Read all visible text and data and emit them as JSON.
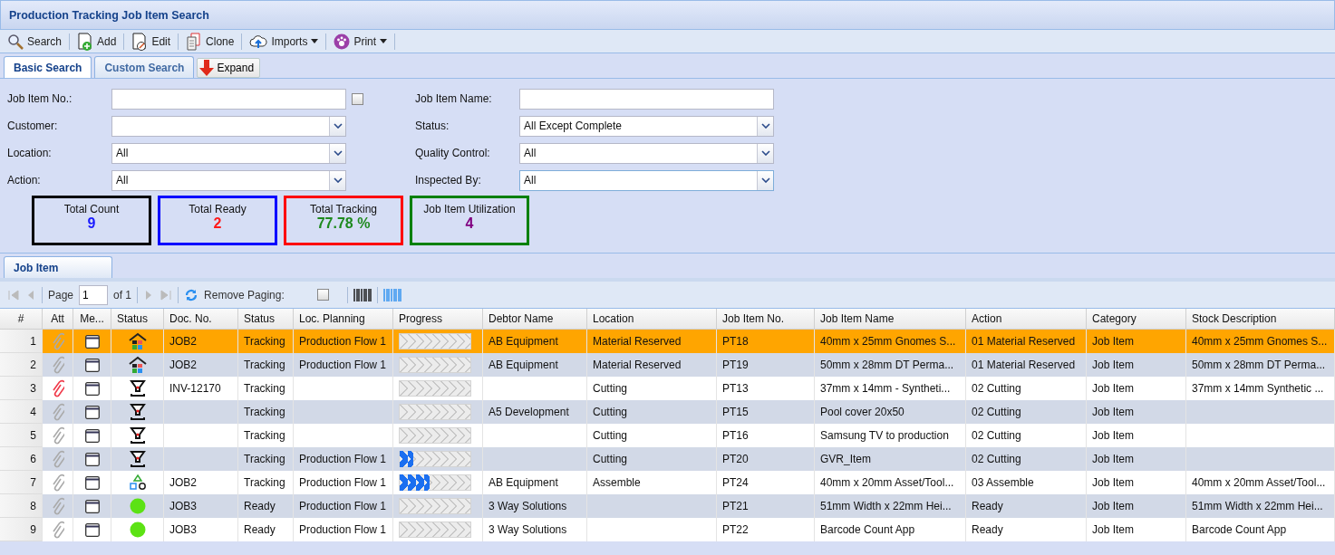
{
  "window": {
    "title": "Production Tracking Job Item Search"
  },
  "toolbar": [
    {
      "label": "Search",
      "kind": "search",
      "menu": false
    },
    {
      "label": "Add",
      "kind": "add",
      "menu": false
    },
    {
      "label": "Edit",
      "kind": "edit",
      "menu": false
    },
    {
      "label": "Clone",
      "kind": "clone",
      "menu": false
    },
    {
      "label": "Imports",
      "kind": "cloud",
      "menu": true
    },
    {
      "label": "Print",
      "kind": "paw",
      "menu": true
    }
  ],
  "search_tabs": [
    {
      "label": "Basic Search",
      "selected": true
    },
    {
      "label": "Custom Search",
      "selected": false
    }
  ],
  "expand_button": {
    "label": "Expand"
  },
  "filters_left": [
    {
      "label": "Job Item No.:",
      "kind": "text",
      "checkbox": true,
      "checked": false
    },
    {
      "label": "Customer:",
      "kind": "select"
    },
    {
      "label": "Location:",
      "kind": "select",
      "value": "All"
    },
    {
      "label": "Action:",
      "kind": "select",
      "value": "All"
    }
  ],
  "filters_right": [
    {
      "label": "Job Item Name:",
      "kind": "text"
    },
    {
      "label": "Status:",
      "kind": "select",
      "value": "All Except Complete"
    },
    {
      "label": "Quality Control:",
      "kind": "select",
      "value": "All"
    },
    {
      "label": "Inspected By:",
      "kind": "select",
      "value": "All",
      "focused": true
    }
  ],
  "summary": [
    {
      "label": "Total Count",
      "color": "#000000",
      "value": {
        "text": "9",
        "color": "#1a1aff"
      }
    },
    {
      "label": "Total Ready",
      "color": "#0000ff",
      "value": {
        "text": "2",
        "color": "#ff1a1a"
      }
    },
    {
      "label": "Total Tracking",
      "color": "#ff0000",
      "value": {
        "text": "77.78 %",
        "color": "#1e8a1e"
      }
    },
    {
      "label": "Job Item Utilization",
      "color": "#008000",
      "value": {
        "text": "4",
        "color": "#800080"
      }
    }
  ],
  "grid_tabs": [
    {
      "label": "Job Item",
      "selected": true
    }
  ],
  "paging": {
    "page_label": "Page",
    "page": "1",
    "of": "of 1",
    "remove_paging": "Remove Paging:",
    "remove_paging_checked": false
  },
  "table": {
    "columns": [
      "#",
      "Att",
      "Me...",
      "Status",
      "Doc. No.",
      "Status",
      "Loc. Planning",
      "Progress",
      "Debtor Name",
      "Location",
      "Job Item No.",
      "Job Item Name",
      "Action",
      "Category",
      "Stock Description"
    ],
    "rows": [
      {
        "num": "1",
        "flagged": false,
        "kind": "house",
        "doc": "JOB2",
        "status": "Tracking",
        "planning": "Production Flow 1",
        "level": 0,
        "debtor": "AB Equipment",
        "location": "Material Reserved",
        "item_no": "PT18",
        "name": "40mm x 25mm Gnomes S...",
        "action": "01 Material Reserved",
        "category": "Job Item",
        "stock": "40mm x 25mm Gnomes S...",
        "selected": true
      },
      {
        "num": "2",
        "flagged": false,
        "kind": "house",
        "doc": "JOB2",
        "status": "Tracking",
        "planning": "Production Flow 1",
        "level": 0,
        "debtor": "AB Equipment",
        "location": "Material Reserved",
        "item_no": "PT19",
        "name": "50mm x 28mm DT Perma...",
        "action": "01 Material Reserved",
        "category": "Job Item",
        "stock": "50mm x 28mm DT Perma...",
        "selected": false
      },
      {
        "num": "3",
        "flagged": true,
        "kind": "funnel",
        "doc": "INV-12170",
        "status": "Tracking",
        "level": 0,
        "location": "Cutting",
        "item_no": "PT13",
        "name": "37mm x 14mm - Syntheti...",
        "action": "02 Cutting",
        "category": "Job Item",
        "stock": "37mm x 14mm Synthetic ...",
        "selected": false
      },
      {
        "num": "4",
        "flagged": false,
        "kind": "funnel",
        "status": "Tracking",
        "level": 0,
        "debtor": "A5 Development",
        "location": "Cutting",
        "item_no": "PT15",
        "name": "Pool cover 20x50",
        "action": "02 Cutting",
        "category": "Job Item",
        "selected": false
      },
      {
        "num": "5",
        "flagged": false,
        "kind": "funnel",
        "status": "Tracking",
        "level": 0,
        "location": "Cutting",
        "item_no": "PT16",
        "name": "Samsung TV to production",
        "action": "02 Cutting",
        "category": "Job Item",
        "selected": false
      },
      {
        "num": "6",
        "flagged": false,
        "kind": "funnel",
        "status": "Tracking",
        "planning": "Production Flow 1",
        "level": 0.2,
        "location": "Cutting",
        "item_no": "PT20",
        "name": "GVR_Item",
        "action": "02 Cutting",
        "category": "Job Item",
        "selected": false
      },
      {
        "num": "7",
        "flagged": false,
        "kind": "shapes",
        "doc": "JOB2",
        "status": "Tracking",
        "planning": "Production Flow 1",
        "level": 0.44,
        "debtor": "AB Equipment",
        "location": "Assemble",
        "item_no": "PT24",
        "name": "40mm x 20mm Asset/Tool...",
        "action": "03 Assemble",
        "category": "Job Item",
        "stock": "40mm x 20mm Asset/Tool...",
        "selected": false
      },
      {
        "num": "8",
        "flagged": false,
        "kind": "dot",
        "doc": "JOB3",
        "status": "Ready",
        "planning": "Production Flow 1",
        "level": 0,
        "debtor": "3 Way Solutions",
        "item_no": "PT21",
        "name": "51mm Width x 22mm Hei...",
        "action": "Ready",
        "category": "Job Item",
        "stock": "51mm Width x 22mm Hei...",
        "selected": false
      },
      {
        "num": "9",
        "flagged": false,
        "kind": "dot",
        "doc": "JOB3",
        "status": "Ready",
        "planning": "Production Flow 1",
        "level": 0,
        "debtor": "3 Way Solutions",
        "item_no": "PT22",
        "name": "Barcode Count App",
        "action": "Ready",
        "category": "Job Item",
        "stock": "Barcode Count App",
        "selected": false
      }
    ]
  }
}
